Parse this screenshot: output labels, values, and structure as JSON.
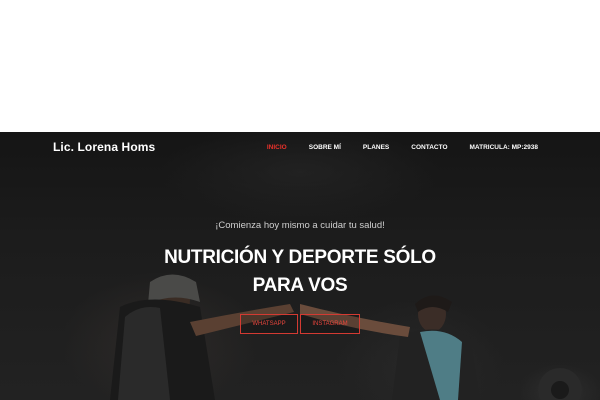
{
  "brand": {
    "name": "Lic. Lorena Homs"
  },
  "nav": {
    "items": [
      {
        "label": "INICIO",
        "active": true
      },
      {
        "label": "SOBRE MÍ",
        "active": false
      },
      {
        "label": "PLANES",
        "active": false
      },
      {
        "label": "CONTACTO",
        "active": false
      },
      {
        "label": "MATRICULA: MP:2938",
        "active": false
      }
    ]
  },
  "hero": {
    "tagline": "¡Comienza hoy mismo a cuidar tu salud!",
    "headline_line1": "NUTRICIÓN Y DEPORTE SÓLO",
    "headline_line2": "PARA VOS",
    "buttons": [
      {
        "label": "WHATSAPP"
      },
      {
        "label": "INSTAGRAM"
      }
    ]
  },
  "colors": {
    "accent": "#e8312a",
    "header_bg": "#141414",
    "text": "#ffffff"
  }
}
